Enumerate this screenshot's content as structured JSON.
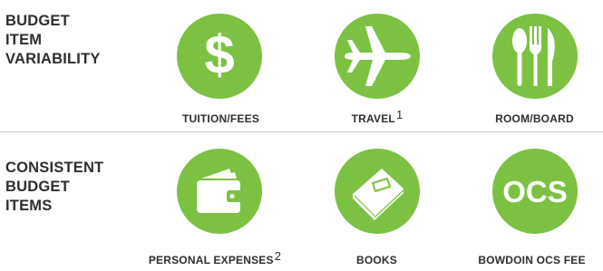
{
  "rows": [
    {
      "heading": [
        "BUDGET",
        "ITEM",
        "VARIABILITY"
      ],
      "items": [
        {
          "label": "TUITION/FEES",
          "note": "",
          "icon": "dollar-icon"
        },
        {
          "label": "TRAVEL",
          "note": "1",
          "icon": "airplane-icon"
        },
        {
          "label": "ROOM/BOARD",
          "note": "",
          "icon": "fork-knife-spoon-icon"
        }
      ]
    },
    {
      "heading": [
        "CONSISTENT",
        "BUDGET",
        "ITEMS"
      ],
      "items": [
        {
          "label": "PERSONAL EXPENSES",
          "note": "2",
          "icon": "wallet-icon"
        },
        {
          "label": "BOOKS",
          "note": "",
          "icon": "book-icon"
        },
        {
          "label": "BOWDOIN OCS FEE",
          "note": "",
          "icon": "ocs-icon",
          "icon_text": "OCS"
        }
      ]
    }
  ],
  "colors": {
    "accent": "#7cc142",
    "text": "#2e2e2e",
    "divider": "#cfcfcf"
  }
}
